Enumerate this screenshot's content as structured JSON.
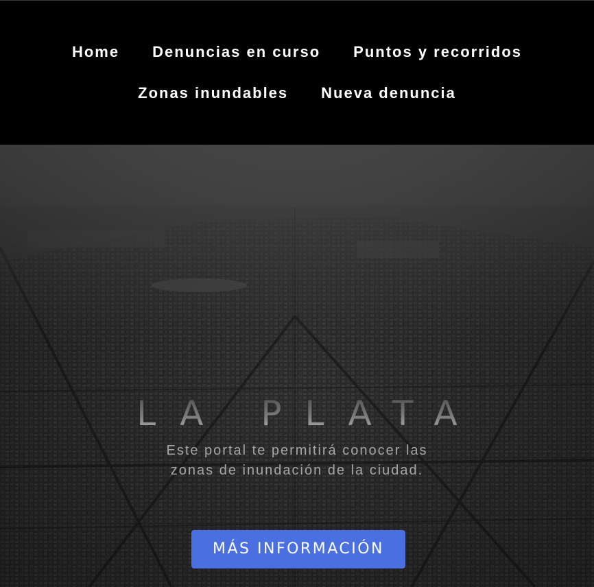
{
  "nav": {
    "row1": [
      "Home",
      "Denuncias en curso",
      "Puntos y recorridos"
    ],
    "row2": [
      "Zonas inundables",
      "Nueva denuncia"
    ]
  },
  "hero": {
    "title": "LA PLATA",
    "description_lines": [
      "Este portal te permitirá conocer las",
      "zonas de inundación de la ciudad."
    ],
    "cta_label": "MÁS INFORMACIÓN"
  },
  "colors": {
    "nav_background": "#000000",
    "nav_text": "#ffffff",
    "cta_background": "#4a6fe0",
    "cta_text": "#ffffff",
    "description_text": "#a6a6a6"
  }
}
